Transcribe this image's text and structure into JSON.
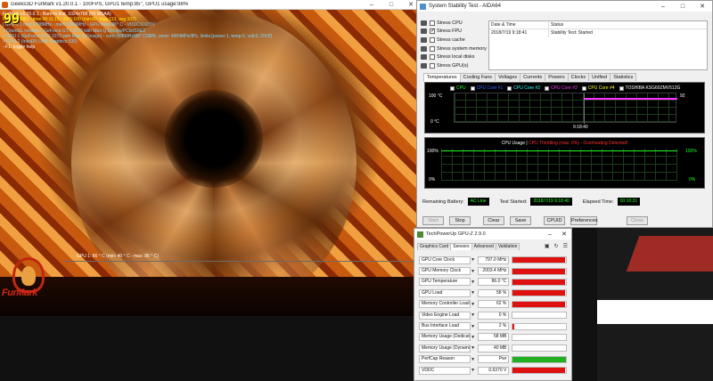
{
  "furmark": {
    "title": "Geeks3D FurMark v1.20.0.1 - 100FPS, GPU1 temp:85°, GPU1 usage:98%",
    "big_counter": "99",
    "osd_line1": "FurMark v1.20.0.1 - Burn-in test, 1024x768 (0X MSAA)",
    "osd_fps": "Frames:5961 - time:00:11:15 - FPS:100 (min:82, max:113, avg:102)",
    "osd_gpu_line": "[ GPU-Z ] core:1798MHz - mem:2003MHz - GPU temp:86° C - VDDC:0.637V",
    "osd_opengl": "> OpenGL renderer: GeForce GTX 1070 with Max-Q Design/PCIe/SSE2",
    "osd_gpu1": "> GPU 1 (GeForce GTX 1070 with Max-Q Design) - core: 898MHz/86° C/98%, mem: 4004MHz/8%, limits:[power:1, temp:0, volt:0, OV:0]",
    "osd_gpu2": "> GPU 2 (Intel(R) UHD Graphics 630)",
    "osd_help": "- F1: toggle help",
    "graph_label": "GPU 1: 86 ° C (min: 40 ° C - max: 86 ° C)",
    "logo_text": "FurMark"
  },
  "aida": {
    "title": "System Stability Test - AIDA64",
    "stress_items": [
      {
        "label": "Stress CPU",
        "checked": false
      },
      {
        "label": "Stress FPU",
        "checked": true
      },
      {
        "label": "Stress cache",
        "checked": false
      },
      {
        "label": "Stress system memory",
        "checked": false
      },
      {
        "label": "Stress local disks",
        "checked": false
      },
      {
        "label": "Stress GPU(s)",
        "checked": false
      }
    ],
    "table_headers": {
      "date": "Date & Time",
      "status": "Status"
    },
    "table_row": {
      "date": "2018/7/19 9:18:41",
      "status": "Stability Test: Started"
    },
    "tabs": [
      "Temperatures",
      "Cooling Fans",
      "Voltages",
      "Currents",
      "Powers",
      "Clocks",
      "Unified",
      "Statistics"
    ],
    "active_tab": "Temperatures",
    "legend": [
      "CPU",
      "CPU Core #1",
      "CPU Core #2",
      "CPU Core #3",
      "CPU Core #4",
      "TOSHIBA KSG60ZMV512G"
    ],
    "temp_axis": {
      "top": "100 °C",
      "bottom": "0 °C",
      "time": "9:18:40",
      "value": "92"
    },
    "usage_header": {
      "usage": "CPU Usage",
      "warning": "CPU Throttling (max: 0%) - Overheating Detected!"
    },
    "usage_axis": {
      "top_left": "100%",
      "bottom_left": "0%",
      "top_right": "100%",
      "bottom_right": "0%"
    },
    "remaining_battery_label": "Remaining Battery:",
    "remaining_battery_value": "AC Line",
    "test_started_label": "Test Started:",
    "test_started_value": "2018/7/19 9:18:40",
    "elapsed_label": "Elapsed Time:",
    "elapsed_value": "00:10:31",
    "buttons": {
      "start": "Start",
      "stop": "Stop",
      "clear": "Clear",
      "save": "Save",
      "cpuid": "CPUID",
      "preferences": "Preferences",
      "close": "Close"
    }
  },
  "gpuz": {
    "title": "TechPowerUp GPU-Z 2.9.0",
    "tabs": [
      "Graphics Card",
      "Sensors",
      "Advanced",
      "Validation"
    ],
    "active_tab": "Sensors",
    "sensors": [
      {
        "name": "GPU Core Clock",
        "value": "797.0 MHz",
        "fill": 0.98,
        "color": "#e01010"
      },
      {
        "name": "GPU Memory Clock",
        "value": "2003.4 MHz",
        "fill": 0.98,
        "color": "#e01010"
      },
      {
        "name": "GPU Temperature",
        "value": "86.0 °C",
        "fill": 0.98,
        "color": "#e01010"
      },
      {
        "name": "GPU Load",
        "value": "58 %",
        "fill": 0.98,
        "color": "#e01010"
      },
      {
        "name": "Memory Controller Load",
        "value": "62 %",
        "fill": 0.98,
        "color": "#e01010"
      },
      {
        "name": "Video Engine Load",
        "value": "0 %",
        "fill": 0,
        "color": "#e01010"
      },
      {
        "name": "Bus Interface Load",
        "value": "2 %",
        "fill": 0.03,
        "color": "#e01010"
      },
      {
        "name": "Memory Usage (Dedicated)",
        "value": "58 MB",
        "fill": 0,
        "color": "#e01010"
      },
      {
        "name": "Memory Usage (Dynamic)",
        "value": "40 MB",
        "fill": 0,
        "color": "#e01010"
      },
      {
        "name": "PerfCap Reason",
        "value": "Pwr",
        "fill": 1.0,
        "color": "#20b020"
      },
      {
        "name": "VDDC",
        "value": "0.6370 V",
        "fill": 0.98,
        "color": "#e01010"
      }
    ]
  }
}
